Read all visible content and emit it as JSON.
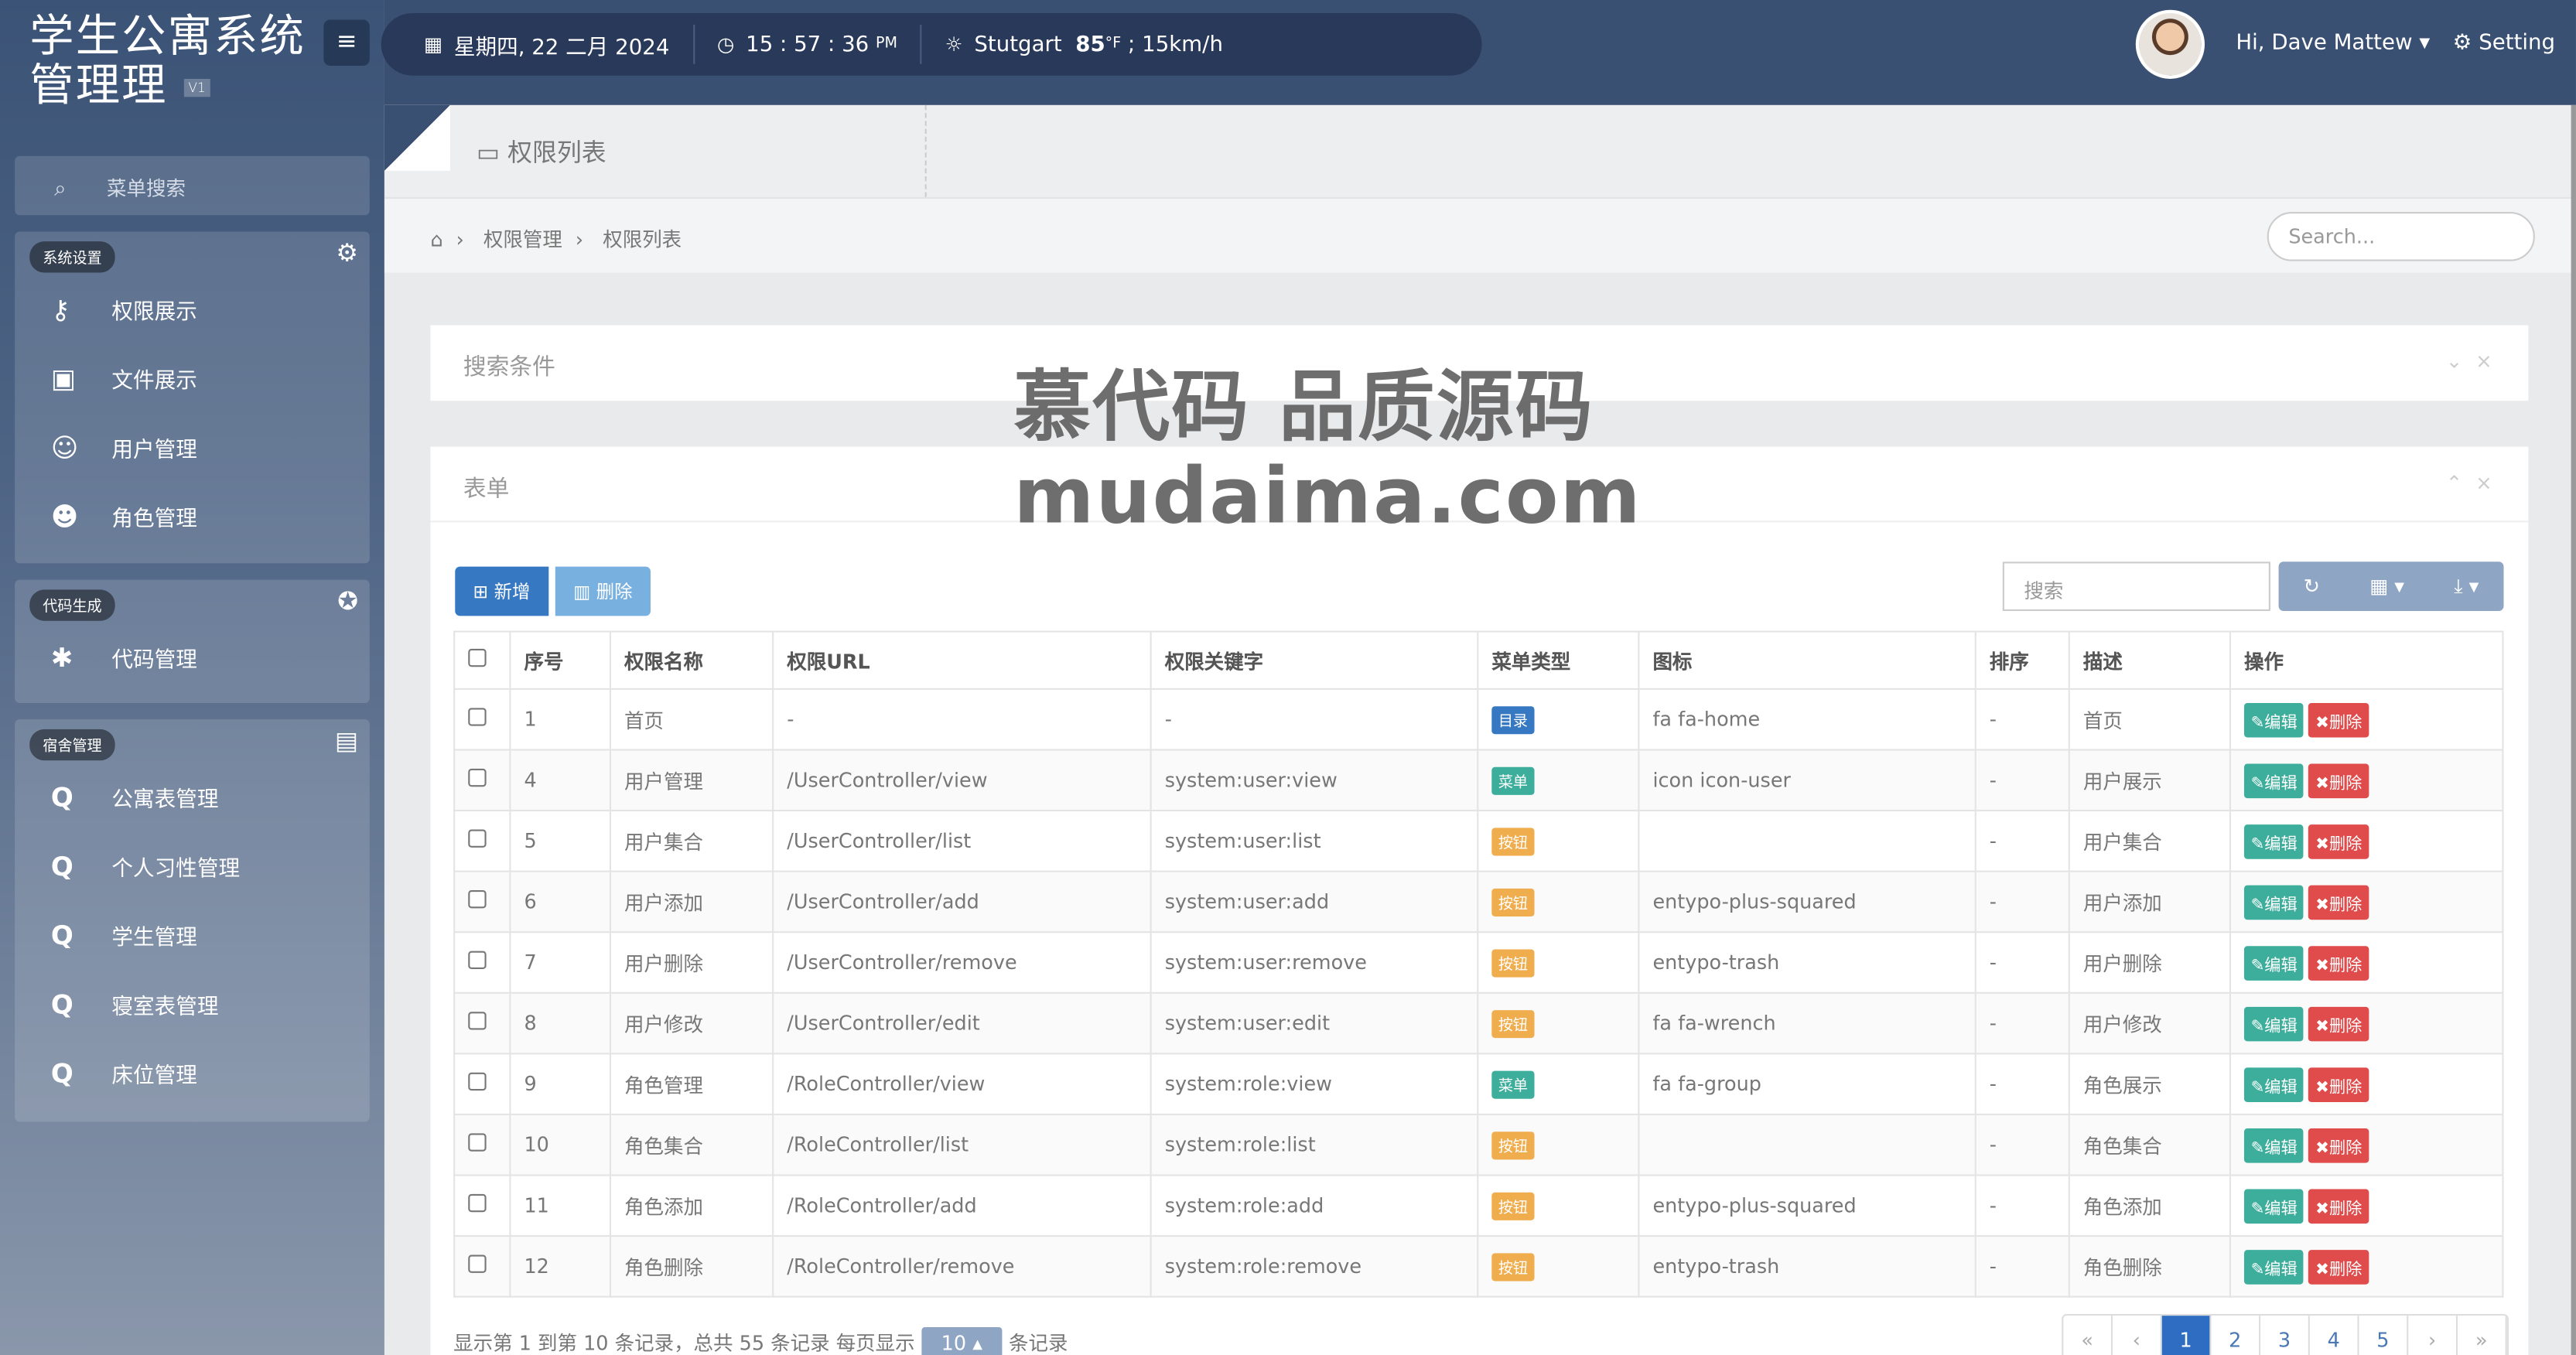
{
  "app": {
    "title_line1": "学生公寓系统",
    "title_line2": "管理理",
    "version": "V1",
    "menu_toggle": "≡"
  },
  "sidebar": {
    "search_placeholder": "菜单搜索",
    "groups": [
      {
        "tag": "系统设置",
        "icon": "gear-icon",
        "items": [
          {
            "label": "权限展示",
            "icon": "key-icon"
          },
          {
            "label": "文件展示",
            "icon": "image-icon"
          },
          {
            "label": "用户管理",
            "icon": "user-icon"
          },
          {
            "label": "角色管理",
            "icon": "users-icon"
          }
        ]
      },
      {
        "tag": "代码生成",
        "icon": "rebel-icon",
        "items": [
          {
            "label": "代码管理",
            "icon": "bug-icon"
          }
        ]
      },
      {
        "tag": "宿舍管理",
        "icon": "contact-icon",
        "items": [
          {
            "label": "公寓表管理",
            "icon": "q-icon"
          },
          {
            "label": "个人习性管理",
            "icon": "q-icon"
          },
          {
            "label": "学生管理",
            "icon": "q-icon"
          },
          {
            "label": "寝室表管理",
            "icon": "q-icon"
          },
          {
            "label": "床位管理",
            "icon": "q-icon"
          }
        ]
      }
    ]
  },
  "topbar": {
    "date": "星期四, 22 二月 2024",
    "time": "15 : 57 : 36",
    "time_suffix": "PM",
    "city": "Stutgart",
    "temp": "85",
    "temp_unit": "°F",
    "wind": "; 15km/h",
    "user": "Hi, Dave Mattew",
    "setting": "Setting"
  },
  "page": {
    "title": "权限列表",
    "breadcrumb": [
      "权限管理",
      "权限列表"
    ],
    "search_placeholder": "Search...",
    "search_panel_title": "搜索条件",
    "form_panel_title": "表单",
    "add_button": "新增",
    "delete_button": "删除",
    "table_search_placeholder": "搜索"
  },
  "table": {
    "headers": [
      "序号",
      "权限名称",
      "权限URL",
      "权限关键字",
      "菜单类型",
      "图标",
      "排序",
      "描述",
      "操作"
    ],
    "edit_label": "编辑",
    "delete_label": "删除",
    "rows": [
      {
        "id": "1",
        "name": "首页",
        "url": "-",
        "key": "-",
        "type": "目录",
        "type_color": "#3778c2",
        "icon": "fa fa-home",
        "sort": "-",
        "desc": "首页"
      },
      {
        "id": "4",
        "name": "用户管理",
        "url": "/UserController/view",
        "key": "system:user:view",
        "type": "菜单",
        "type_color": "#3dae9b",
        "icon": "icon icon-user",
        "sort": "-",
        "desc": "用户展示"
      },
      {
        "id": "5",
        "name": "用户集合",
        "url": "/UserController/list",
        "key": "system:user:list",
        "type": "按钮",
        "type_color": "#f0ad4e",
        "icon": "",
        "sort": "-",
        "desc": "用户集合"
      },
      {
        "id": "6",
        "name": "用户添加",
        "url": "/UserController/add",
        "key": "system:user:add",
        "type": "按钮",
        "type_color": "#f0ad4e",
        "icon": "entypo-plus-squared",
        "sort": "-",
        "desc": "用户添加"
      },
      {
        "id": "7",
        "name": "用户删除",
        "url": "/UserController/remove",
        "key": "system:user:remove",
        "type": "按钮",
        "type_color": "#f0ad4e",
        "icon": "entypo-trash",
        "sort": "-",
        "desc": "用户删除"
      },
      {
        "id": "8",
        "name": "用户修改",
        "url": "/UserController/edit",
        "key": "system:user:edit",
        "type": "按钮",
        "type_color": "#f0ad4e",
        "icon": "fa fa-wrench",
        "sort": "-",
        "desc": "用户修改"
      },
      {
        "id": "9",
        "name": "角色管理",
        "url": "/RoleController/view",
        "key": "system:role:view",
        "type": "菜单",
        "type_color": "#3dae9b",
        "icon": "fa fa-group",
        "sort": "-",
        "desc": "角色展示"
      },
      {
        "id": "10",
        "name": "角色集合",
        "url": "/RoleController/list",
        "key": "system:role:list",
        "type": "按钮",
        "type_color": "#f0ad4e",
        "icon": "",
        "sort": "-",
        "desc": "角色集合"
      },
      {
        "id": "11",
        "name": "角色添加",
        "url": "/RoleController/add",
        "key": "system:role:add",
        "type": "按钮",
        "type_color": "#f0ad4e",
        "icon": "entypo-plus-squared",
        "sort": "-",
        "desc": "角色添加"
      },
      {
        "id": "12",
        "name": "角色删除",
        "url": "/RoleController/remove",
        "key": "system:role:remove",
        "type": "按钮",
        "type_color": "#f0ad4e",
        "icon": "entypo-trash",
        "sort": "-",
        "desc": "角色删除"
      }
    ]
  },
  "pagination": {
    "info": "显示第 1 到第 10 条记录，总共 55 条记录 每页显示",
    "page_size": "10",
    "suffix": "条记录",
    "pages": [
      "«",
      "‹",
      "1",
      "2",
      "3",
      "4",
      "5",
      "›",
      "»"
    ],
    "current": "1"
  },
  "watermark": {
    "line1": "慕代码 品质源码",
    "line2": "mudaima.com"
  },
  "colors": {
    "primary": "#2f6dc2",
    "success": "#3dae9b",
    "danger": "#e04b4b",
    "warning": "#f0ad4e",
    "topbar": "#3a5073"
  }
}
